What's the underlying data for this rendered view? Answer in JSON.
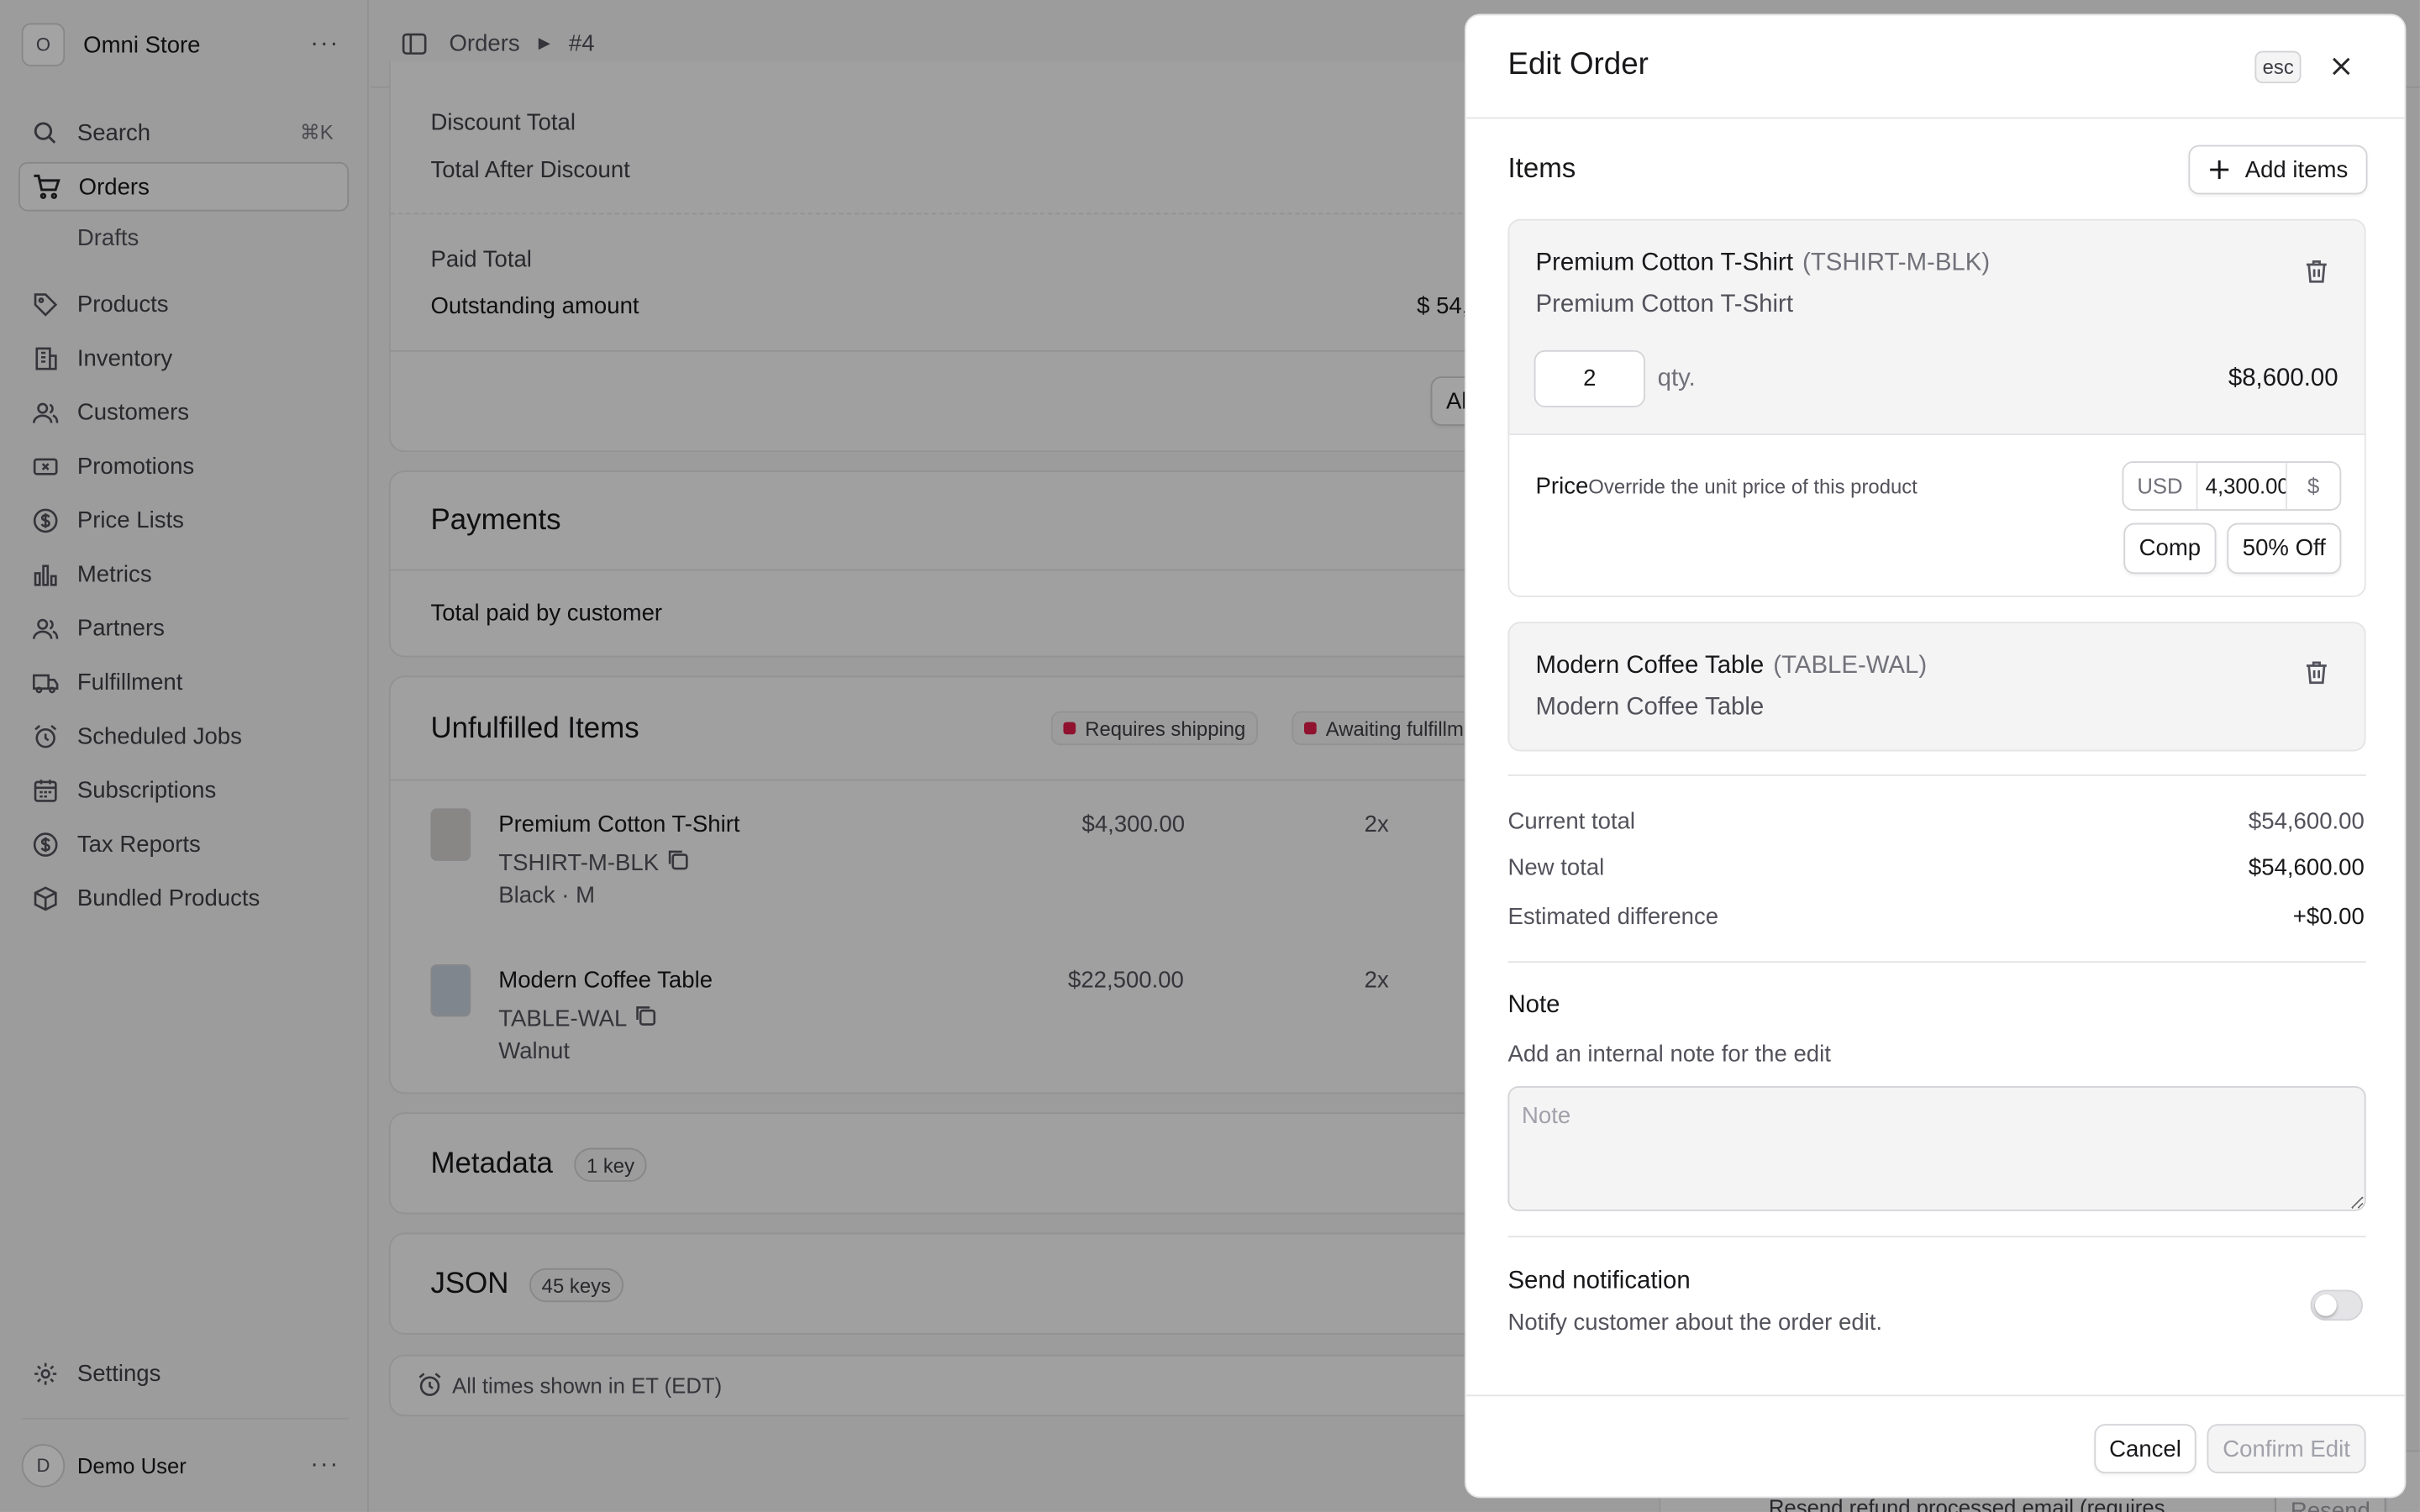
{
  "sidebar": {
    "store_initial": "O",
    "store_name": "Omni Store",
    "search_label": "Search",
    "search_shortcut": "⌘K",
    "items": [
      {
        "label": "Orders",
        "icon": "cart-icon"
      },
      {
        "label": "Drafts"
      },
      {
        "label": "Products",
        "icon": "tag-icon"
      },
      {
        "label": "Inventory",
        "icon": "building-icon"
      },
      {
        "label": "Customers",
        "icon": "users-icon"
      },
      {
        "label": "Promotions",
        "icon": "ticket-icon"
      },
      {
        "label": "Price Lists",
        "icon": "dollar-circle-icon"
      },
      {
        "label": "Metrics",
        "icon": "bar-chart-icon"
      },
      {
        "label": "Partners",
        "icon": "users-icon"
      },
      {
        "label": "Fulfillment",
        "icon": "truck-icon"
      },
      {
        "label": "Scheduled Jobs",
        "icon": "alarm-clock-icon"
      },
      {
        "label": "Subscriptions",
        "icon": "calendar-icon"
      },
      {
        "label": "Tax Reports",
        "icon": "dollar-circle-icon"
      },
      {
        "label": "Bundled Products",
        "icon": "box-icon"
      }
    ],
    "settings_label": "Settings",
    "user_initial": "D",
    "user_name": "Demo User"
  },
  "breadcrumb": {
    "parent": "Orders",
    "current": "#4"
  },
  "summary": {
    "discount_total": "Discount Total",
    "total_after_discount": "Total After Discount",
    "paid_total": "Paid Total",
    "outstanding_amount": "Outstanding amount",
    "outstanding_value_partial": "$ 54,",
    "action_partial": "Al"
  },
  "payments": {
    "title": "Payments",
    "total_paid_label": "Total paid by customer"
  },
  "unfulfilled": {
    "title": "Unfulfilled Items",
    "badges": [
      "Requires shipping",
      "Awaiting fulfillm"
    ],
    "items": [
      {
        "name": "Premium Cotton T-Shirt",
        "sku": "TSHIRT-M-BLK",
        "variant": "Black · M",
        "price": "$4,300.00",
        "qty": "2x"
      },
      {
        "name": "Modern Coffee Table",
        "sku": "TABLE-WAL",
        "variant": "Walnut",
        "price": "$22,500.00",
        "qty": "2x"
      }
    ]
  },
  "metadata": {
    "title": "Metadata",
    "badge": "1 key"
  },
  "json_section": {
    "title": "JSON",
    "badge": "45 keys"
  },
  "timezone_note": "All times shown in ET (EDT)",
  "background_partial": {
    "resend_text": "Resend refund processed email (requires",
    "resend_button": "Resend"
  },
  "drawer": {
    "title": "Edit Order",
    "esc_label": "esc",
    "items_title": "Items",
    "add_items_label": "Add items",
    "items": [
      {
        "name": "Premium Cotton T-Shirt",
        "sku": "(TSHIRT-M-BLK)",
        "subtitle": "Premium Cotton T-Shirt",
        "qty": "2",
        "qty_label": "qty.",
        "line_total": "$8,600.00",
        "price_label": "Price",
        "price_desc": "Override the unit price of this product",
        "currency": "USD",
        "unit_price": "4,300.00",
        "currency_symbol": "$",
        "comp_label": "Comp",
        "discount_label": "50% Off"
      },
      {
        "name": "Modern Coffee Table",
        "sku": "(TABLE-WAL)",
        "subtitle": "Modern Coffee Table"
      }
    ],
    "totals": {
      "current_label": "Current total",
      "current_value": "$54,600.00",
      "new_label": "New total",
      "new_value": "$54,600.00",
      "diff_label": "Estimated difference",
      "diff_value": "+$0.00"
    },
    "note": {
      "title": "Note",
      "subtitle": "Add an internal note for the edit",
      "placeholder": "Note",
      "value": ""
    },
    "notification": {
      "title": "Send notification",
      "subtitle": "Notify customer about the order edit.",
      "enabled": false
    },
    "cancel_label": "Cancel",
    "confirm_label": "Confirm Edit"
  }
}
